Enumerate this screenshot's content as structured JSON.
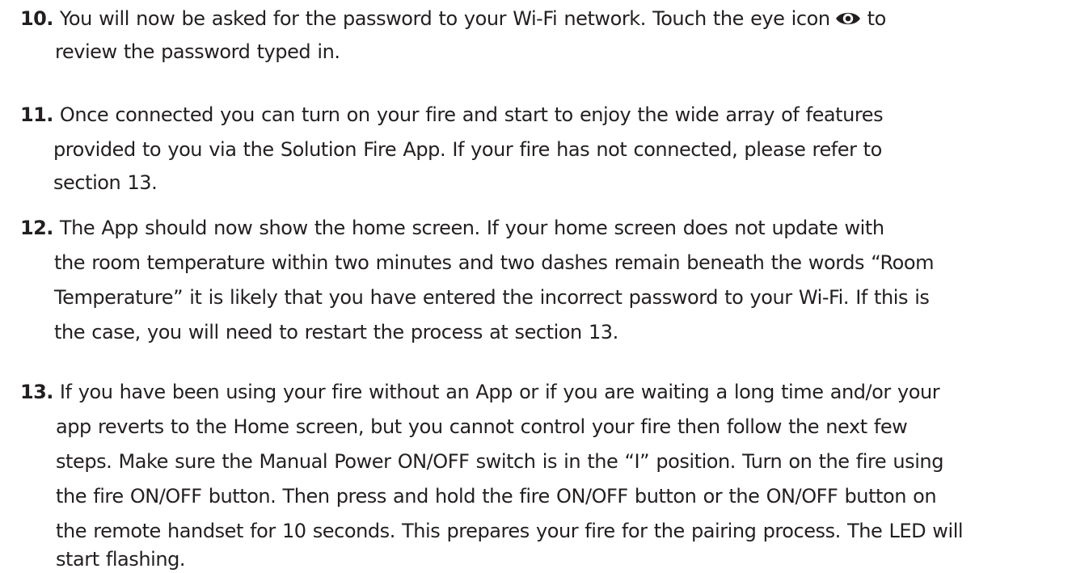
{
  "steps": [
    {
      "number": "10.",
      "lines": [
        "You will now be asked for the password to your Wi-Fi network. Touch the eye icon",
        "to",
        "review the password typed in."
      ],
      "icon": "eye-icon"
    },
    {
      "number": "11.",
      "lines": [
        "Once connected you can turn on your fire and start to enjoy the wide array of features",
        "provided to you via the Solution Fire App. If your fire has not connected, please refer to",
        "section 13."
      ]
    },
    {
      "number": "12.",
      "lines": [
        "The App should now show the home screen. If your home screen does not update with",
        "the room temperature within two minutes and two dashes remain beneath the words “Room",
        "Temperature” it is likely that you have entered the incorrect password to your Wi-Fi. If this is",
        "the case, you will need to restart the process at section 13."
      ]
    },
    {
      "number": "13.",
      "lines": [
        "If you have been using your fire without an App or if you are waiting a long time and/or your",
        "app reverts to the Home screen, but you cannot control your fire then follow the next few",
        "steps. Make sure the Manual Power ON/OFF switch is in the “I” position. Turn on the fire using",
        "the fire ON/OFF button. Then press and hold the fire ON/OFF button or the ON/OFF button on",
        "the remote handset for 10 seconds. This prepares your fire for the pairing process. The LED will",
        "start flashing."
      ]
    }
  ]
}
